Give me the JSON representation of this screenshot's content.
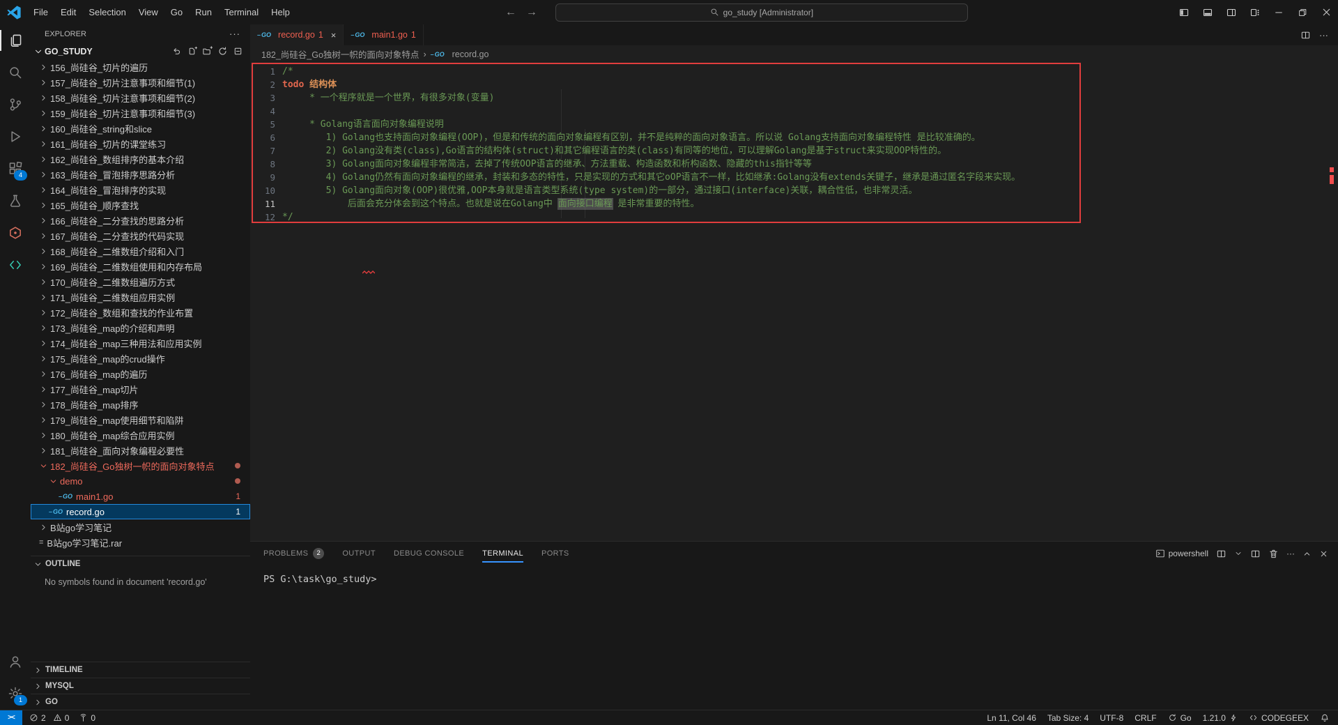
{
  "title_bar": {
    "app_menus": [
      "File",
      "Edit",
      "Selection",
      "View",
      "Go",
      "Run",
      "Terminal",
      "Help"
    ],
    "search_text": "go_study [Administrator]"
  },
  "activity_bar": {
    "items": [
      {
        "name": "explorer",
        "active": true
      },
      {
        "name": "search"
      },
      {
        "name": "source-control"
      },
      {
        "name": "run-debug"
      },
      {
        "name": "extensions",
        "badge": "4"
      },
      {
        "name": "testing"
      },
      {
        "name": "plugin-red"
      },
      {
        "name": "codegeex"
      }
    ],
    "bottom_items": [
      {
        "name": "account"
      },
      {
        "name": "settings",
        "badge": "1"
      }
    ]
  },
  "sidebar": {
    "title": "EXPLORER",
    "workspace": "GO_STUDY",
    "tree": [
      {
        "label": "156_尚硅谷_切片的遍历",
        "depth": 0,
        "kind": "folder"
      },
      {
        "label": "157_尚硅谷_切片注意事项和细节(1)",
        "depth": 0,
        "kind": "folder"
      },
      {
        "label": "158_尚硅谷_切片注意事项和细节(2)",
        "depth": 0,
        "kind": "folder"
      },
      {
        "label": "159_尚硅谷_切片注意事项和细节(3)",
        "depth": 0,
        "kind": "folder"
      },
      {
        "label": "160_尚硅谷_string和slice",
        "depth": 0,
        "kind": "folder"
      },
      {
        "label": "161_尚硅谷_切片的课堂练习",
        "depth": 0,
        "kind": "folder"
      },
      {
        "label": "162_尚硅谷_数组排序的基本介绍",
        "depth": 0,
        "kind": "folder"
      },
      {
        "label": "163_尚硅谷_冒泡排序思路分析",
        "depth": 0,
        "kind": "folder"
      },
      {
        "label": "164_尚硅谷_冒泡排序的实现",
        "depth": 0,
        "kind": "folder"
      },
      {
        "label": "165_尚硅谷_顺序查找",
        "depth": 0,
        "kind": "folder"
      },
      {
        "label": "166_尚硅谷_二分查找的思路分析",
        "depth": 0,
        "kind": "folder"
      },
      {
        "label": "167_尚硅谷_二分查找的代码实现",
        "depth": 0,
        "kind": "folder"
      },
      {
        "label": "168_尚硅谷_二维数组介绍和入门",
        "depth": 0,
        "kind": "folder"
      },
      {
        "label": "169_尚硅谷_二维数组使用和内存布局",
        "depth": 0,
        "kind": "folder"
      },
      {
        "label": "170_尚硅谷_二维数组遍历方式",
        "depth": 0,
        "kind": "folder"
      },
      {
        "label": "171_尚硅谷_二维数组应用实例",
        "depth": 0,
        "kind": "folder"
      },
      {
        "label": "172_尚硅谷_数组和查找的作业布置",
        "depth": 0,
        "kind": "folder"
      },
      {
        "label": "173_尚硅谷_map的介绍和声明",
        "depth": 0,
        "kind": "folder"
      },
      {
        "label": "174_尚硅谷_map三种用法和应用实例",
        "depth": 0,
        "kind": "folder"
      },
      {
        "label": "175_尚硅谷_map的crud操作",
        "depth": 0,
        "kind": "folder"
      },
      {
        "label": "176_尚硅谷_map的遍历",
        "depth": 0,
        "kind": "folder"
      },
      {
        "label": "177_尚硅谷_map切片",
        "depth": 0,
        "kind": "folder"
      },
      {
        "label": "178_尚硅谷_map排序",
        "depth": 0,
        "kind": "folder"
      },
      {
        "label": "179_尚硅谷_map使用细节和陷阱",
        "depth": 0,
        "kind": "folder"
      },
      {
        "label": "180_尚硅谷_map综合应用实例",
        "depth": 0,
        "kind": "folder"
      },
      {
        "label": "181_尚硅谷_面向对象编程必要性",
        "depth": 0,
        "kind": "folder"
      },
      {
        "label": "182_尚硅谷_Go独树一帜的面向对象特点",
        "depth": 0,
        "kind": "folder",
        "expanded": true,
        "error": true,
        "badge": "dot"
      },
      {
        "label": "demo",
        "depth": 1,
        "kind": "folder",
        "expanded": true,
        "error": true,
        "badge": "dot"
      },
      {
        "label": "main1.go",
        "depth": 2,
        "kind": "go",
        "error": true,
        "badge": "1"
      },
      {
        "label": "record.go",
        "depth": 1,
        "kind": "go",
        "selected": true,
        "badge": "1"
      },
      {
        "label": "B站go学习笔记",
        "depth": 0,
        "kind": "folder"
      },
      {
        "label": "B站go学习笔记.rar",
        "depth": 0,
        "kind": "rar"
      }
    ],
    "outline": {
      "title": "OUTLINE",
      "empty_text": "No symbols found in document 'record.go'"
    },
    "bottom_sections": [
      "TIMELINE",
      "MYSQL",
      "GO"
    ]
  },
  "editor": {
    "tabs": [
      {
        "label": "record.go",
        "badge": "1",
        "active": true,
        "closable": true
      },
      {
        "label": "main1.go",
        "badge": "1",
        "active": false,
        "closable": false
      }
    ],
    "breadcrumb": {
      "folder": "182_尚硅谷_Go独树一帜的面向对象特点",
      "file": "record.go",
      "separator": "›"
    },
    "lines": [
      {
        "n": 1,
        "seg": [
          {
            "t": "/*",
            "s": "comment"
          }
        ]
      },
      {
        "n": 2,
        "seg": [
          {
            "t": "todo",
            "s": "todo"
          },
          {
            "t": " ",
            "s": "comment"
          },
          {
            "t": "结构体",
            "s": "struct"
          }
        ]
      },
      {
        "n": 3,
        "seg": [
          {
            "t": "     * 一个程序就是一个世界，有很多对象(变量)",
            "s": "comment"
          }
        ]
      },
      {
        "n": 4,
        "seg": []
      },
      {
        "n": 5,
        "seg": [
          {
            "t": "     * Golang语言面向对象编程说明",
            "s": "comment"
          }
        ]
      },
      {
        "n": 6,
        "seg": [
          {
            "t": "        1) Golang也支持面向对象编程(OOP)，但是和传统的面向对象编程有区别，并不是纯粹的面向对象语言。所以说 Golang支持面向对象编程特性 是比较准确的。",
            "s": "comment"
          }
        ]
      },
      {
        "n": 7,
        "seg": [
          {
            "t": "        2) Golang没有类(class),Go语言的结构体(struct)和其它编程语言的类(class)有同等的地位，可以理解Golang是基于struct来实现OOP特性的。",
            "s": "comment"
          }
        ]
      },
      {
        "n": 8,
        "seg": [
          {
            "t": "        3) Golang面向对象编程非常简洁，去掉了传统OOP语言的继承、方法重载、构造函数和析构函数、隐藏的this指针等等",
            "s": "comment"
          }
        ]
      },
      {
        "n": 9,
        "seg": [
          {
            "t": "        4) Golang仍然有面向对象编程的继承，封装和多态的特性，只是实现的方式和其它oOP语言不一样，比如继承:Golang没有extends关键子，继承是通过匿名字段来实现。",
            "s": "comment"
          }
        ]
      },
      {
        "n": 10,
        "seg": [
          {
            "t": "        5) Golang面向对象(OOP)很优雅,OOP本身就是语言类型系统(type system)的一部分，通过接口(interface)关联，耦合性低，也非常灵活。",
            "s": "comment"
          }
        ]
      },
      {
        "n": 11,
        "active": true,
        "seg": [
          {
            "t": "            后面会充分体会到这个特点。也就是说在Golang中 ",
            "s": "comment"
          },
          {
            "t": "面向接口编程",
            "s": "hl"
          },
          {
            "t": " 是非常重要的特性。",
            "s": "comment"
          }
        ]
      },
      {
        "n": 12,
        "seg": [
          {
            "t": "*/",
            "s": "comment"
          }
        ]
      }
    ]
  },
  "panel": {
    "tabs": [
      {
        "label": "PROBLEMS",
        "badge": "2"
      },
      {
        "label": "OUTPUT"
      },
      {
        "label": "DEBUG CONSOLE"
      },
      {
        "label": "TERMINAL",
        "active": true
      },
      {
        "label": "PORTS"
      }
    ],
    "shell_label": "powershell",
    "terminal_prompt": "PS G:\\task\\go_study>"
  },
  "status_bar": {
    "errors": "2",
    "warnings": "0",
    "ports": "0",
    "right_items": [
      {
        "label": "Ln 11, Col 46"
      },
      {
        "label": "Tab Size: 4"
      },
      {
        "label": "UTF-8"
      },
      {
        "label": "CRLF"
      },
      {
        "label": "Go",
        "icon": "sync"
      },
      {
        "label": "1.21.0",
        "icon_after": "spark"
      },
      {
        "label": "CODEGEEX",
        "icon": "codegeex-sm"
      }
    ]
  },
  "colors": {
    "accent": "#0078d4",
    "error_text": "#ef5f50",
    "comment_green": "#6a9955",
    "selection_bg": "#04395e",
    "annotation_red": "#e13d3d"
  }
}
